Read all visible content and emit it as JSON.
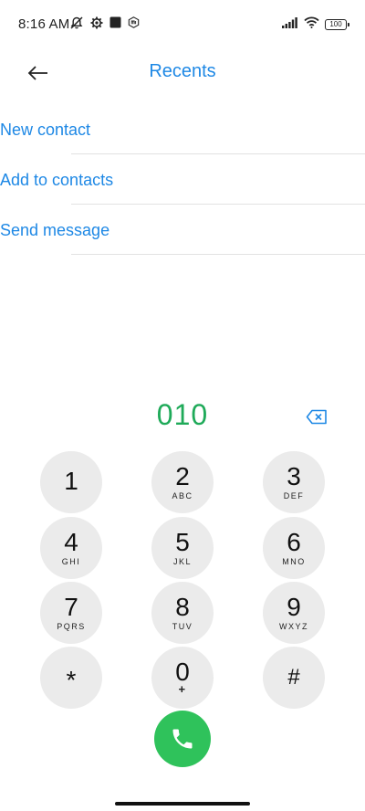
{
  "status_bar": {
    "time": "8:16 AM",
    "left_icons": [
      "notifications-off-icon",
      "settings-gear-icon",
      "square-icon",
      "mi-icon"
    ],
    "right_icons": [
      "signal-icon",
      "wifi-icon",
      "battery-icon"
    ],
    "battery_level": "100"
  },
  "header": {
    "title": "Recents",
    "back_icon": "arrow-left-icon"
  },
  "actions": [
    {
      "label": "New contact"
    },
    {
      "label": "Add to contacts"
    },
    {
      "label": "Send message"
    }
  ],
  "dialer": {
    "number": "010",
    "backspace_icon": "backspace-icon",
    "accent_color": "#1faa59"
  },
  "keypad": [
    {
      "digit": "1",
      "letters": ""
    },
    {
      "digit": "2",
      "letters": "ABC"
    },
    {
      "digit": "3",
      "letters": "DEF"
    },
    {
      "digit": "4",
      "letters": "GHI"
    },
    {
      "digit": "5",
      "letters": "JKL"
    },
    {
      "digit": "6",
      "letters": "MNO"
    },
    {
      "digit": "7",
      "letters": "PQRS"
    },
    {
      "digit": "8",
      "letters": "TUV"
    },
    {
      "digit": "9",
      "letters": "WXYZ"
    },
    {
      "digit": "*",
      "letters": ""
    },
    {
      "digit": "0",
      "letters": "+"
    },
    {
      "digit": "#",
      "letters": ""
    }
  ],
  "call": {
    "icon": "phone-icon",
    "color": "#2fc25b"
  },
  "colors": {
    "link_blue": "#1e88e5",
    "key_background": "#ebebeb"
  }
}
